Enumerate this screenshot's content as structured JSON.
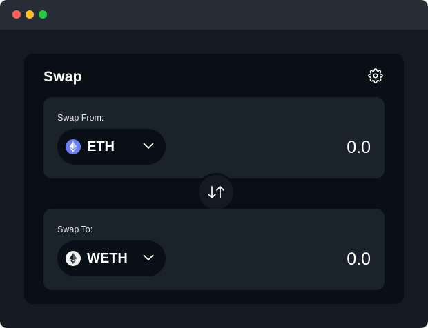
{
  "window": {
    "controls": [
      "close",
      "minimize",
      "maximize"
    ]
  },
  "swap": {
    "title": "Swap",
    "settings_icon": "gear-icon",
    "from": {
      "label": "Swap From:",
      "token": "ETH",
      "token_icon": "ethereum-icon",
      "amount": "0.0"
    },
    "to": {
      "label": "Swap To:",
      "token": "WETH",
      "token_icon": "weth-icon",
      "amount": "0.0"
    },
    "switch_icon": "swap-arrows-icon"
  },
  "colors": {
    "window_bg": "#131a23",
    "titlebar_bg": "#262d37",
    "card_bg": "#080f17",
    "panel_bg": "#1a222c",
    "eth_icon_bg": "#6b7ff0",
    "weth_icon_bg": "#f2f2f2",
    "text": "#ffffff"
  }
}
